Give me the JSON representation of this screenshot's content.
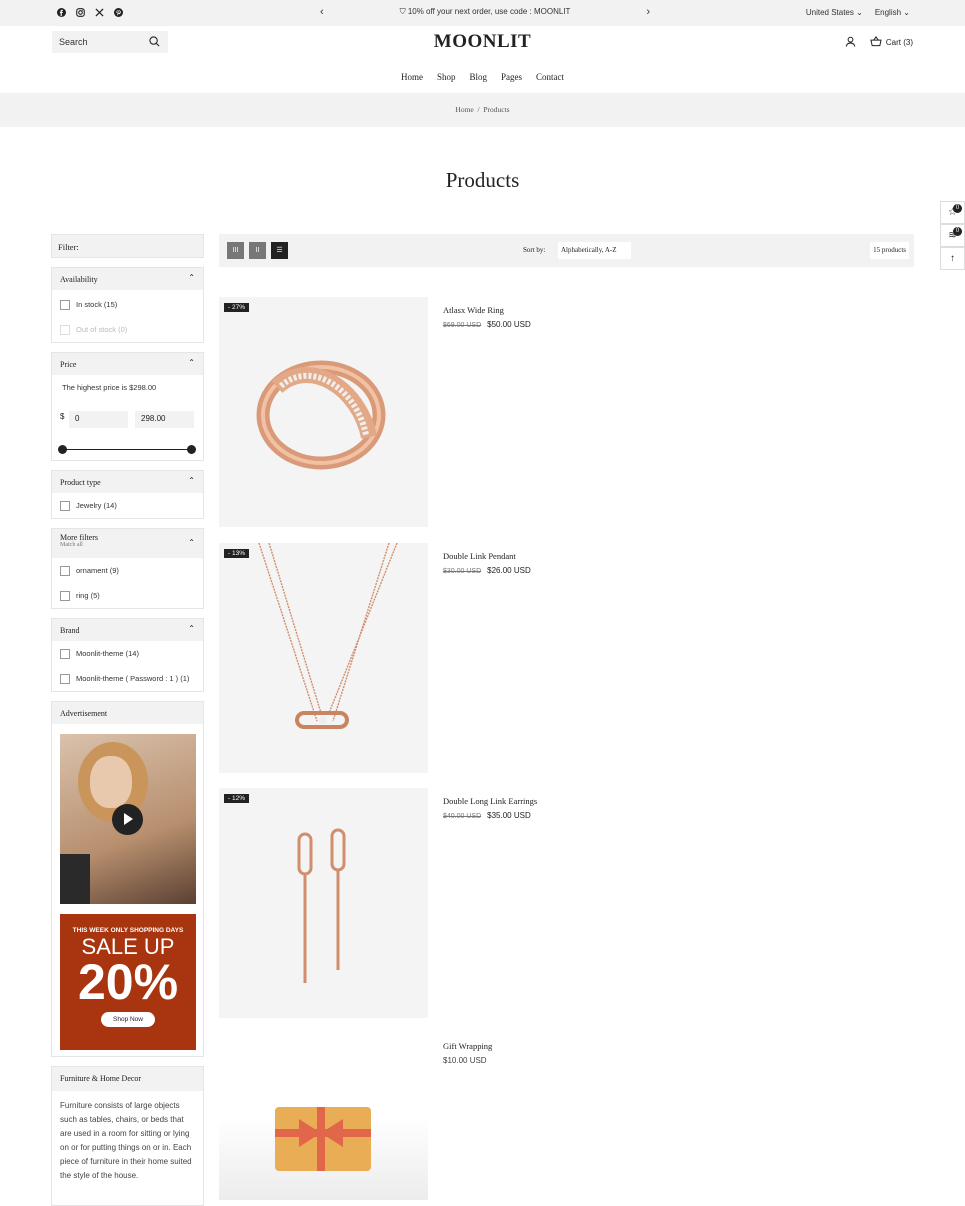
{
  "topbar": {
    "social_icons": [
      "facebook-icon",
      "instagram-icon",
      "x-icon",
      "pinterest-icon"
    ],
    "promo": "10% off your next order, use code : MOONLIT",
    "country": "United States",
    "language": "English"
  },
  "header": {
    "search_placeholder": "Search",
    "logo": "MOONLIT",
    "cart_label": "Cart (3)"
  },
  "nav": [
    "Home",
    "Shop",
    "Blog",
    "Pages",
    "Contact"
  ],
  "breadcrumb": {
    "home": "Home",
    "sep": "/",
    "current": "Products"
  },
  "page_title": "Products",
  "side_tools": {
    "wishlist_count": "0",
    "compare_count": "0"
  },
  "filters": {
    "title": "Filter:",
    "availability": {
      "title": "Availability",
      "options": [
        "In stock (15)",
        "Out of stock (0)"
      ]
    },
    "price": {
      "title": "Price",
      "note": "The highest price is $298.00",
      "currency": "$",
      "min": "0",
      "max": "298.00"
    },
    "product_type": {
      "title": "Product type",
      "options": [
        "Jewelry (14)"
      ]
    },
    "more_filters": {
      "title": "More filters",
      "subtitle": "Match all",
      "options": [
        "ornament (9)",
        "ring (5)"
      ]
    },
    "brand": {
      "title": "Brand",
      "options": [
        "Moonlit-theme (14)",
        "Moonlit-theme ( Password : 1 ) (1)"
      ]
    },
    "advertisement": {
      "title": "Advertisement",
      "banner_line1": "THIS WEEK ONLY SHOPPING DAYS",
      "banner_line2": "SALE UP",
      "banner_line3": "20%",
      "banner_button": "Shop Now"
    },
    "furniture": {
      "title": "Furniture & Home Decor",
      "text": "Furniture consists of large objects such as tables, chairs, or beds that are used in a room for sitting or lying on or for putting things on or in. Each piece of furniture in their home suited the style of the house."
    }
  },
  "toolbar": {
    "sort_label": "Sort by:",
    "sort_value": "Alphabetically, A-Z",
    "count": "15 products"
  },
  "products": [
    {
      "name": "Atlasx Wide Ring",
      "old_price": "$69.00 USD",
      "price": "$50.00 USD",
      "discount": "- 27%"
    },
    {
      "name": "Double Link Pendant",
      "old_price": "$30.00 USD",
      "price": "$26.00 USD",
      "discount": "- 13%"
    },
    {
      "name": "Double Long Link Earrings",
      "old_price": "$40.00 USD",
      "price": "$35.00 USD",
      "discount": "- 12%"
    },
    {
      "name": "Gift Wrapping",
      "old_price": "",
      "price": "$10.00 USD",
      "discount": ""
    }
  ],
  "colors": {
    "accent": "#222222",
    "ad_banner": "#a8350f",
    "panel": "#f2f2f2"
  }
}
